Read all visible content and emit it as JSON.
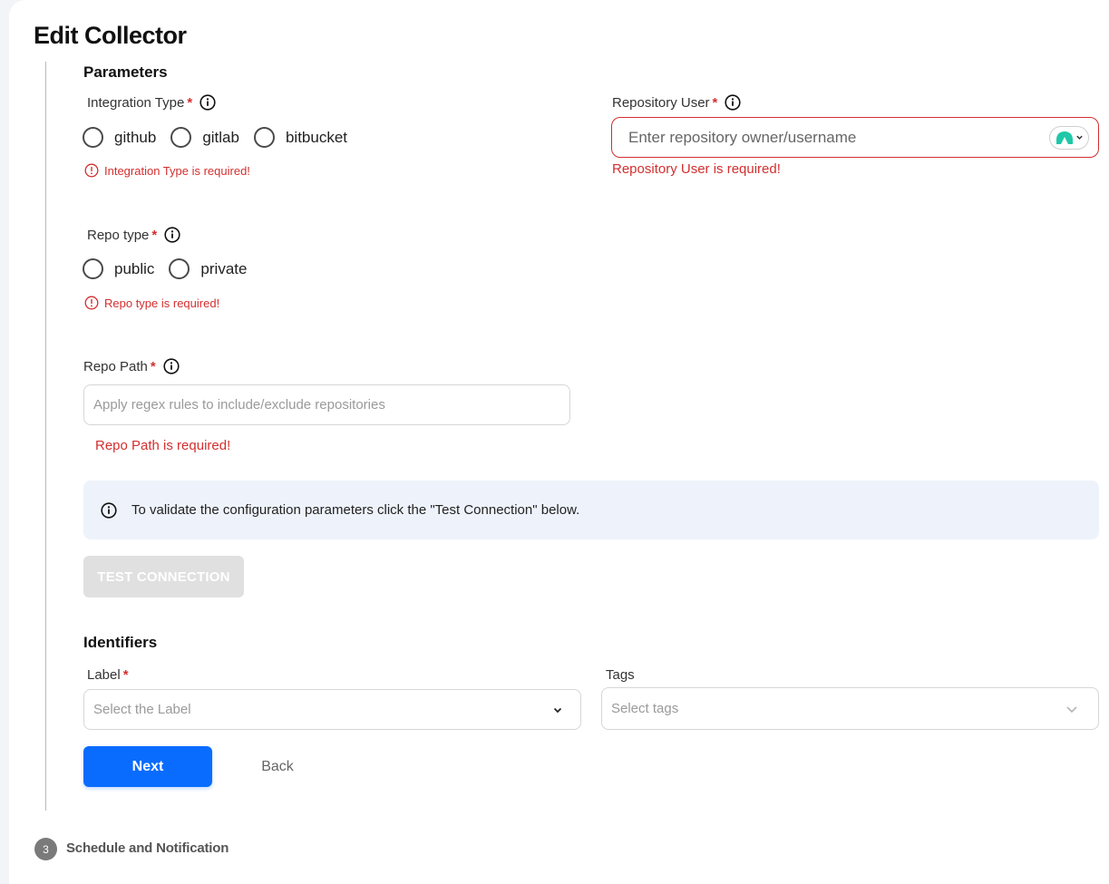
{
  "page": {
    "title": "Edit Collector"
  },
  "parameters": {
    "section_title": "Parameters",
    "integration_type": {
      "label": "Integration Type",
      "required_mark": "*",
      "options": [
        "github",
        "gitlab",
        "bitbucket"
      ],
      "error": "Integration Type is required!"
    },
    "repo_type": {
      "label": "Repo type",
      "required_mark": "*",
      "options": [
        "public",
        "private"
      ],
      "error": "Repo type is required!"
    },
    "repo_path": {
      "label": "Repo Path",
      "required_mark": "*",
      "placeholder": "Apply regex rules to include/exclude repositories",
      "value": "",
      "error": "Repo Path is required!"
    },
    "repository_user": {
      "label": "Repository User",
      "required_mark": "*",
      "placeholder": "Enter repository owner/username",
      "value": "",
      "error": "Repository User is required!"
    },
    "info_banner": "To validate the configuration parameters click the \"Test Connection\" below.",
    "test_connection_label": "TEST CONNECTION"
  },
  "identifiers": {
    "section_title": "Identifiers",
    "label_field": {
      "label": "Label",
      "required_mark": "*",
      "placeholder": "Select the Label"
    },
    "tags_field": {
      "label": "Tags",
      "placeholder": "Select tags"
    }
  },
  "actions": {
    "next_label": "Next",
    "back_label": "Back"
  },
  "steps": {
    "next_step_number": "3",
    "next_step_label": "Schedule and Notification"
  },
  "colors": {
    "accent": "#0a6cff",
    "error": "#d32f2f",
    "banner_bg": "#eef3fb",
    "disabled_button": "#e0e0e0"
  },
  "icons": {
    "info": "info-icon",
    "error": "error-circle-icon",
    "chevron": "chevron-down-icon",
    "extension": "password-manager-icon"
  }
}
